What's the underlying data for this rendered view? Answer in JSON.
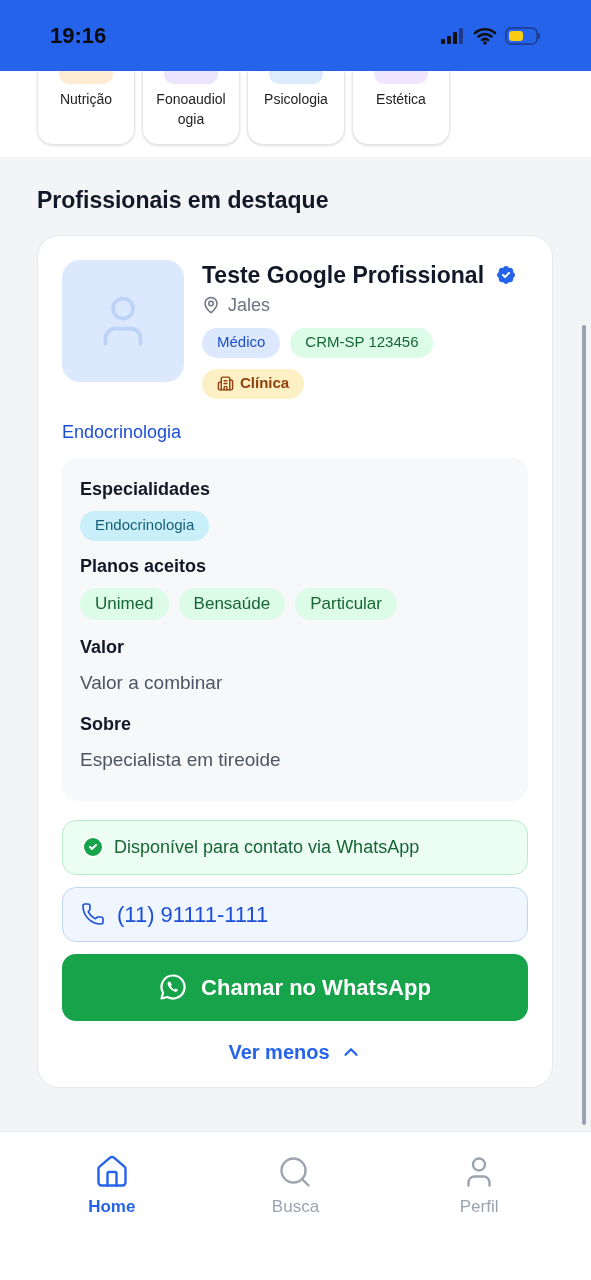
{
  "status_bar": {
    "time": "19:16"
  },
  "categories": [
    {
      "label": "Nutrição",
      "color": "#fdebd3"
    },
    {
      "label": "Fonoaudiologia",
      "color": "#ede4fd"
    },
    {
      "label": "Psicologia",
      "color": "#dcecfd"
    },
    {
      "label": "Estética",
      "color": "#f0e6fd"
    }
  ],
  "section_title": "Profissionais em destaque",
  "professional": {
    "name": "Teste Google Profissional",
    "verified": true,
    "location": "Jales",
    "tags": [
      {
        "label": "Médico",
        "kind": "role"
      },
      {
        "label": "CRM-SP 123456",
        "kind": "license"
      },
      {
        "label": "Clínica",
        "kind": "clinic"
      }
    ],
    "main_specialty": "Endocrinologia",
    "details": {
      "specialties_title": "Especialidades",
      "specialties": [
        "Endocrinologia"
      ],
      "plans_title": "Planos aceitos",
      "plans": [
        "Unimed",
        "Bensaúde",
        "Particular"
      ],
      "price_title": "Valor",
      "price": "Valor a combinar",
      "about_title": "Sobre",
      "about": "Especialista em tireoide"
    },
    "whatsapp_available": "Disponível para contato via WhatsApp",
    "phone": "(11) 91111-1111",
    "whatsapp_button": "Chamar no WhatsApp",
    "toggle": "Ver menos",
    "expanded": true
  },
  "bottom_nav": [
    {
      "label": "Home",
      "kind": "home",
      "selected": true
    },
    {
      "label": "Busca",
      "kind": "search",
      "selected": false
    },
    {
      "label": "Perfil",
      "kind": "profile",
      "selected": false
    }
  ]
}
